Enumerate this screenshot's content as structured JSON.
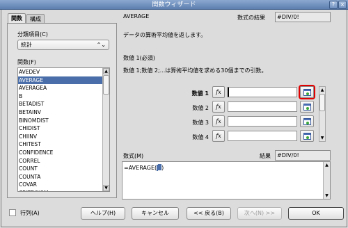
{
  "window": {
    "title": "関数ウィザード"
  },
  "titlebar_buttons": {
    "help": "?",
    "close": "×"
  },
  "tabs": [
    {
      "label": "関数"
    },
    {
      "label": "構成"
    }
  ],
  "left": {
    "category_label": "分類項目(C)",
    "category_value": "統計",
    "functions_label": "関数(F)",
    "functions": [
      "AVEDEV",
      "AVERAGE",
      "AVERAGEA",
      "B",
      "BETADIST",
      "BETAINV",
      "BINOMDIST",
      "CHIDIST",
      "CHIINV",
      "CHITEST",
      "CONFIDENCE",
      "CORREL",
      "COUNT",
      "COUNTA",
      "COVAR",
      "CRITBINOM"
    ],
    "selected_index": 1
  },
  "right": {
    "function_name": "AVERAGE",
    "result_label": "数式の結果",
    "result_value": "#DIV/0!",
    "description": "データの算術平均値を返します。",
    "arg_heading": "数値 1(必須)",
    "arg_description": "数値 1;数値 2;...は算術平均値を求める30個までの引数。",
    "args": [
      {
        "label": "数値 1",
        "value": ""
      },
      {
        "label": "数値 2",
        "value": ""
      },
      {
        "label": "数値 3",
        "value": ""
      },
      {
        "label": "数値 4",
        "value": ""
      }
    ],
    "fx_glyph": "fx",
    "formula_label": "数式(M)",
    "formula_result_label": "結果",
    "formula_result_value": "#DIV/0!",
    "formula_text": "=AVERAGE(",
    "formula_cursor": "",
    "formula_close": ")"
  },
  "footer": {
    "array_label": "行列(A)",
    "help": "ヘルプ(H)",
    "cancel": "キャンセル",
    "back": "<< 戻る(B)",
    "next": "次へ(N) >>",
    "ok": "OK"
  },
  "colors": {
    "highlight_outline": "#e00000",
    "selection": "#4a6ea9"
  }
}
